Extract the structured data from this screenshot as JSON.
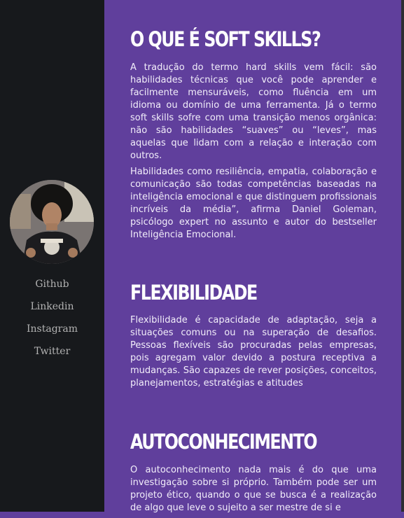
{
  "sidebar": {
    "links": [
      "Github",
      "Linkedin",
      "Instagram",
      "Twitter"
    ]
  },
  "sections": [
    {
      "title": "O QUE É SOFT SKILLS?",
      "paragraphs": [
        "A tradução do termo hard skills vem fácil: são habilidades técnicas que você pode aprender e facilmente mensuráveis, como fluência em um idioma ou domínio de uma ferramenta. Já o termo soft skills sofre com uma transição menos orgânica: não são habilidades “suaves” ou “leves”, mas aquelas que lidam com a relação e interação com outros.",
        "Habilidades como resiliência, empatia, colaboração e comunicação são todas competências baseadas na inteligência emocional e que distinguem profissionais incríveis da média”, afirma Daniel Goleman, psicólogo expert no assunto e autor do bestseller Inteligência Emocional."
      ]
    },
    {
      "title": "FLEXIBILIDADE",
      "paragraphs": [
        "Flexibilidade é capacidade de adaptação, seja a situações comuns ou na superação de desafios. Pessoas flexíveis são procuradas pelas empresas, pois agregam valor devido a postura receptiva a mudanças. São capazes de rever posições, conceitos, planejamentos, estratégias e atitudes"
      ]
    },
    {
      "title": "AUTOCONHECIMENTO",
      "paragraphs": [
        "O autoconhecimento nada mais é do que uma investigação sobre si próprio. Também pode ser um projeto ético, quando o que se busca é a realização de algo que leve o sujeito a ser mestre de si e"
      ]
    }
  ],
  "colors": {
    "sidebar_bg": "#17191c",
    "main_bg": "#603f9c",
    "link_text": "#b3b3b3",
    "body_text": "#f2eefa"
  }
}
